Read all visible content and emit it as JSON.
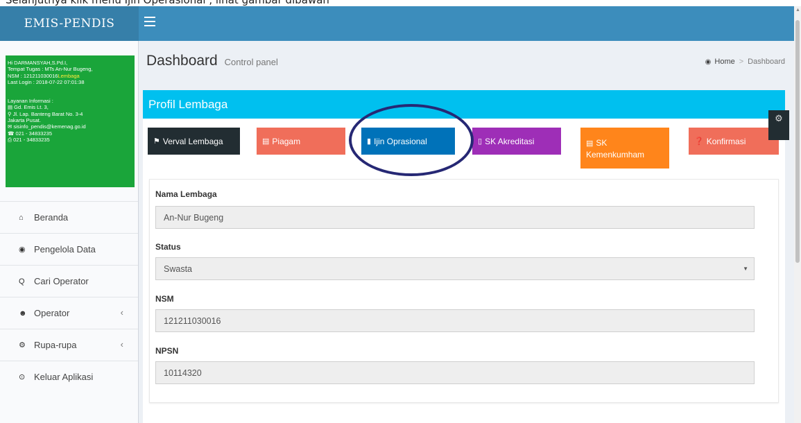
{
  "caption": "Selanjutnya klik menu Ijin Operasional , lihat gambar dibawah",
  "app": {
    "logo": "EMIS-PENDIS"
  },
  "user_box": {
    "greeting": "Hi DARMANSYAH,S.Pd.I,",
    "tugas": "Tempat Tugas : MTs An-Nur Bugeng,",
    "nsm_prefix": "NSM : 121211030016",
    "nsm_link": "Lembaga",
    "last_login": "Last Login : 2018-07-22 07:01:38",
    "layanan_title": "Layanan Informasi :",
    "building": "Gd. Emis Lt. 3,",
    "street": "Jl. Lap. Banteng Barat No. 3-4",
    "city": "Jakarta Pusat.",
    "email": "sisinfo_pendis@kemenag.go.id",
    "phone": "021 - 34833235",
    "fax": "021 - 34833235"
  },
  "sidebar": {
    "items": [
      {
        "label": "Beranda",
        "icon": "home-icon"
      },
      {
        "label": "Pengelola Data",
        "icon": "dashboard-icon"
      },
      {
        "label": "Cari Operator",
        "icon": "search-icon"
      },
      {
        "label": "Operator",
        "icon": "users-icon",
        "chevron": "‹"
      },
      {
        "label": "Rupa-rupa",
        "icon": "cogs-icon",
        "chevron": "‹"
      },
      {
        "label": "Keluar Aplikasi",
        "icon": "power-icon"
      }
    ]
  },
  "header": {
    "title": "Dashboard",
    "subtitle": "Control panel"
  },
  "breadcrumb": {
    "home": "Home",
    "separator": ">",
    "current": "Dashboard"
  },
  "panel": {
    "title": "Profil Lembaga",
    "buttons": {
      "verval": "Verval Lembaga",
      "piagam": "Piagam",
      "ijin": "Ijin Oprasional",
      "sk_akreditasi": "SK Akreditasi",
      "sk_kem_line1": "SK",
      "sk_kem_line2": "Kemenkumham",
      "konfirmasi": "Konfirmasi"
    }
  },
  "form": {
    "nama_label": "Nama Lembaga",
    "nama_value": "An-Nur Bugeng",
    "status_label": "Status",
    "status_value": "Swasta",
    "nsm_label": "NSM",
    "nsm_value": "121211030016",
    "npsn_label": "NPSN",
    "npsn_value": "10114320"
  },
  "colors": {
    "topbar": "#3c8dbc",
    "logo_bg": "#367fa9",
    "panel_heading": "#00c0ef",
    "user_box": "#1aa53a",
    "highlight_ellipse": "#262874"
  }
}
